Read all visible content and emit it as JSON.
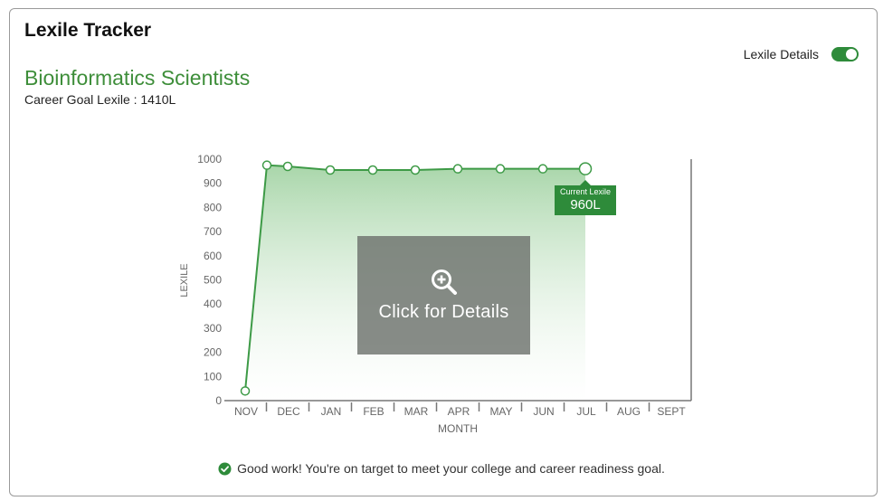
{
  "header": {
    "title": "Lexile Tracker"
  },
  "toggle": {
    "label": "Lexile Details",
    "on": true
  },
  "career": {
    "name": "Bioinformatics Scientists",
    "goal_text": "Career Goal Lexile : 1410L"
  },
  "overlay": {
    "text": "Click for Details"
  },
  "tooltip": {
    "label": "Current Lexile",
    "value": "960L"
  },
  "status": {
    "text": "Good work! You're on target to meet your college and career readiness goal."
  },
  "colors": {
    "accent": "#2e8b3a",
    "line": "#3d9a46",
    "fill_top": "#a9d6aa",
    "axis": "#777777",
    "tick_text": "#666666"
  },
  "chart_data": {
    "type": "area",
    "categories": [
      "NOV",
      "DEC",
      "JAN",
      "FEB",
      "MAR",
      "APR",
      "MAY",
      "JUN",
      "JUL",
      "AUG",
      "SEPT"
    ],
    "x": [
      "NOV",
      "NOV",
      "DEC",
      "JAN",
      "FEB",
      "MAR",
      "APR",
      "MAY",
      "JUN",
      "JUL"
    ],
    "values": [
      40,
      975,
      970,
      955,
      955,
      955,
      960,
      960,
      960,
      960
    ],
    "xlabel": "MONTH",
    "ylabel": "LEXILE",
    "ylim": [
      0,
      1000
    ],
    "yticks": [
      0,
      100,
      200,
      300,
      400,
      500,
      600,
      700,
      800,
      900,
      1000
    ],
    "grid": false,
    "legend": "none"
  }
}
